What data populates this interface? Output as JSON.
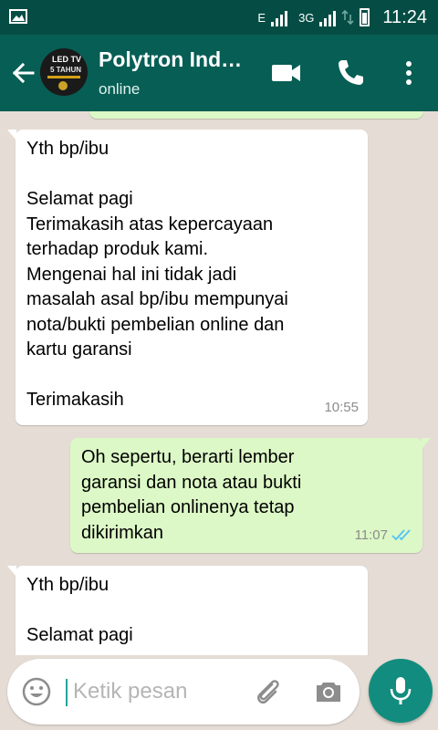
{
  "status_bar": {
    "network_type_1": "E",
    "network_type_2": "3G",
    "time": "11:24"
  },
  "header": {
    "contact_name": "Polytron Ind…",
    "contact_status": "online",
    "avatar_text_1": "LED TV",
    "avatar_text_2": "5 TAHUN"
  },
  "messages": [
    {
      "direction": "incoming",
      "lines": [
        "Yth bp/ibu",
        "",
        "Selamat pagi",
        "Terimakasih atas kepercayaan",
        "terhadap produk kami.",
        "Mengenai hal ini tidak jadi",
        "masalah asal bp/ibu mempunyai",
        "nota/bukti pembelian online dan",
        "kartu garansi",
        "",
        "Terimakasih"
      ],
      "time": "10:55"
    },
    {
      "direction": "outgoing",
      "lines": [
        "Oh sepertu, berarti lember",
        "garansi dan nota atau bukti",
        "pembelian onlinenya tetap",
        "dikirimkan"
      ],
      "time": "11:07",
      "status_icon": "double-check-read-icon"
    },
    {
      "direction": "incoming",
      "lines": [
        "Yth bp/ibu",
        "",
        "Selamat pagi"
      ]
    }
  ],
  "composer": {
    "placeholder": "Ketik pesan"
  },
  "colors": {
    "status_bar": "#054d44",
    "app_bar": "#075e54",
    "chat_background": "#e5ddd5",
    "outgoing_bubble": "#dcf8c6",
    "incoming_bubble": "#ffffff",
    "read_ticks": "#4fc3f7",
    "mic_button": "#128c7e"
  }
}
